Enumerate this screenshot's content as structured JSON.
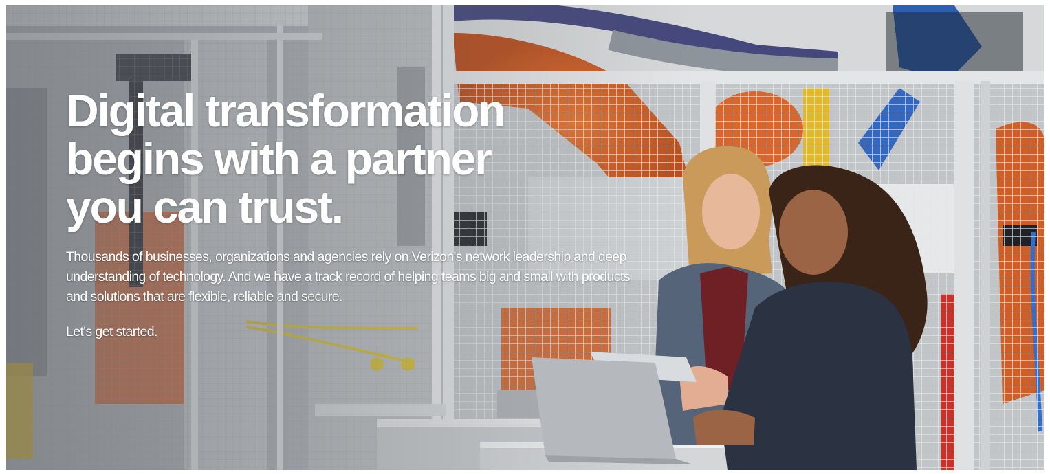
{
  "hero": {
    "headline_lines": [
      "Digital transformation",
      "begins with a partner",
      "you can trust."
    ],
    "body": "Thousands of businesses, organizations and agencies rely on Verizon's network leadership and deep understanding of technology. And we have a track record of helping teams big and small with products and solutions that are flexible, reliable and secure.",
    "cta_label": "Let's get started.",
    "image_subject": "two-women-with-laptop-in-factory-photo"
  },
  "colors": {
    "text": "#ffffff",
    "robot_orange": "#d2622a",
    "cage_grey": "#cfd2d4",
    "jacket_blue": "#56647a",
    "jacket_navy": "#2b3242"
  }
}
